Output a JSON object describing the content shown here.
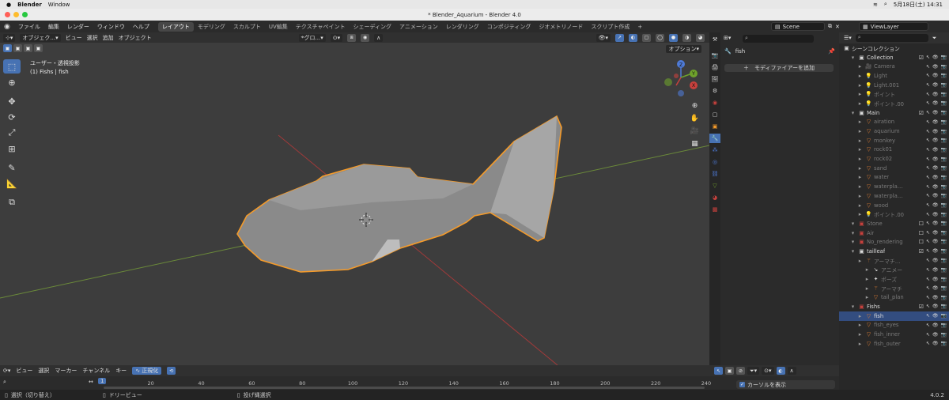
{
  "macbar": {
    "app": "Blender",
    "window": "Window",
    "clock": "5月18日(土) 14:31"
  },
  "window_title": "* Blender_Aquarium - Blender 4.0",
  "topbar": {
    "menus": [
      "ファイル",
      "編集",
      "レンダー",
      "ウィンドウ",
      "ヘルプ"
    ],
    "workspaces": [
      "レイアウト",
      "モデリング",
      "スカルプト",
      "UV編集",
      "テクスチャペイント",
      "シェーディング",
      "アニメーション",
      "レンダリング",
      "コンポジティング",
      "ジオメトリノード",
      "スクリプト作成"
    ],
    "active_workspace": 0,
    "add": "+",
    "scene": "Scene",
    "viewlayer": "ViewLayer"
  },
  "viewport": {
    "mode": "オブジェク...",
    "menus": [
      "ビュー",
      "選択",
      "追加",
      "オブジェクト"
    ],
    "transform": "グロ...",
    "info_line1": "ユーザー・透視投影",
    "info_line2": "(1) Fishs | fish",
    "options": "オプション"
  },
  "gizmo": {
    "z": "Z",
    "y": "Y",
    "x": "X"
  },
  "properties": {
    "object_name": "fish",
    "add_modifier": "モディファイアーを追加"
  },
  "outliner": {
    "title": "シーンコレクション",
    "rows": [
      {
        "label": "Collection",
        "depth": 1,
        "type": "coll",
        "on": true
      },
      {
        "label": "Camera",
        "depth": 2,
        "type": "cam",
        "on": false
      },
      {
        "label": "Light",
        "depth": 2,
        "type": "light",
        "on": false
      },
      {
        "label": "Light.001",
        "depth": 2,
        "type": "light",
        "on": false
      },
      {
        "label": "ポイント",
        "depth": 2,
        "type": "light",
        "on": false
      },
      {
        "label": "ポイント.00",
        "depth": 2,
        "type": "light",
        "on": false
      },
      {
        "label": "Main",
        "depth": 1,
        "type": "coll",
        "on": true
      },
      {
        "label": "airation",
        "depth": 2,
        "type": "mesh",
        "on": false
      },
      {
        "label": "aquarium",
        "depth": 2,
        "type": "mesh",
        "on": false
      },
      {
        "label": "monkey",
        "depth": 2,
        "type": "mesh",
        "on": false
      },
      {
        "label": "rock01",
        "depth": 2,
        "type": "mesh",
        "on": false
      },
      {
        "label": "rock02",
        "depth": 2,
        "type": "mesh",
        "on": false
      },
      {
        "label": "sand",
        "depth": 2,
        "type": "mesh",
        "on": false
      },
      {
        "label": "water",
        "depth": 2,
        "type": "mesh",
        "on": false
      },
      {
        "label": "waterplant_",
        "depth": 2,
        "type": "mesh",
        "on": false
      },
      {
        "label": "waterplant_",
        "depth": 2,
        "type": "mesh",
        "on": false
      },
      {
        "label": "wood",
        "depth": 2,
        "type": "mesh",
        "on": false
      },
      {
        "label": "ポイント.00",
        "depth": 2,
        "type": "light",
        "on": false
      },
      {
        "label": "Stone",
        "depth": 1,
        "type": "collr",
        "on": false
      },
      {
        "label": "Air",
        "depth": 1,
        "type": "collr",
        "on": false
      },
      {
        "label": "No_rendering",
        "depth": 1,
        "type": "collr",
        "on": false
      },
      {
        "label": "tailleaf",
        "depth": 1,
        "type": "coll",
        "on": true
      },
      {
        "label": "アーマチュア",
        "depth": 2,
        "type": "arm",
        "on": false
      },
      {
        "label": "アニメー",
        "depth": 3,
        "type": "anim",
        "on": false
      },
      {
        "label": "ポーズ",
        "depth": 3,
        "type": "pose",
        "on": false
      },
      {
        "label": "アーマチ",
        "depth": 3,
        "type": "arm",
        "on": false
      },
      {
        "label": "tail_plan",
        "depth": 3,
        "type": "mesh",
        "on": false
      },
      {
        "label": "Fishs",
        "depth": 1,
        "type": "collr",
        "on": true
      },
      {
        "label": "fish",
        "depth": 2,
        "type": "mesh",
        "on": true,
        "selected": true
      },
      {
        "label": "fish_eyes",
        "depth": 2,
        "type": "mesh",
        "on": false
      },
      {
        "label": "fish_inner",
        "depth": 2,
        "type": "mesh",
        "on": false
      },
      {
        "label": "fish_outer",
        "depth": 2,
        "type": "mesh",
        "on": false
      }
    ]
  },
  "timeline": {
    "menus": [
      "ビュー",
      "選択",
      "マーカー",
      "チャンネル",
      "キー"
    ],
    "normalize": "正規化",
    "current_frame": "1",
    "ticks": [
      "20",
      "40",
      "60",
      "80",
      "100",
      "120",
      "140",
      "160",
      "180",
      "200",
      "220",
      "240"
    ],
    "show_cursor": "カーソルを表示"
  },
  "status": {
    "select": "選択（切り替え）",
    "dolly": "ドリービュー",
    "lasso": "投げ縄選択",
    "version": "4.0.2"
  }
}
